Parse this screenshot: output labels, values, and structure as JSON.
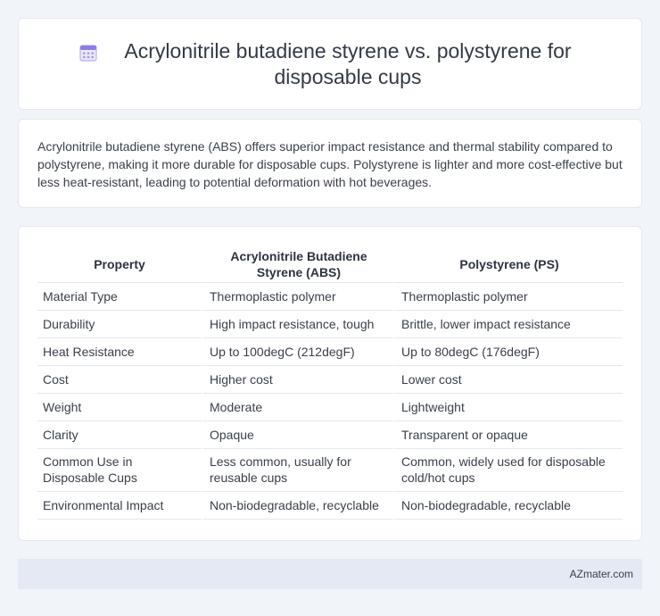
{
  "header": {
    "title": "Acrylonitrile butadiene styrene vs. polystyrene for disposable cups",
    "icon": "calendar-icon"
  },
  "summary": {
    "text": "Acrylonitrile butadiene styrene (ABS) offers superior impact resistance and thermal stability compared to polystyrene, making it more durable for disposable cups. Polystyrene is lighter and more cost-effective but less heat-resistant, leading to potential deformation with hot beverages."
  },
  "table": {
    "headers": [
      "Property",
      "Acrylonitrile Butadiene Styrene (ABS)",
      "Polystyrene (PS)"
    ],
    "rows": [
      [
        "Material Type",
        "Thermoplastic polymer",
        "Thermoplastic polymer"
      ],
      [
        "Durability",
        "High impact resistance, tough",
        "Brittle, lower impact resistance"
      ],
      [
        "Heat Resistance",
        "Up to 100degC (212degF)",
        "Up to 80degC (176degF)"
      ],
      [
        "Cost",
        "Higher cost",
        "Lower cost"
      ],
      [
        "Weight",
        "Moderate",
        "Lightweight"
      ],
      [
        "Clarity",
        "Opaque",
        "Transparent or opaque"
      ],
      [
        "Common Use in Disposable Cups",
        "Less common, usually for reusable cups",
        "Common, widely used for disposable cold/hot cups"
      ],
      [
        "Environmental Impact",
        "Non-biodegradable, recyclable",
        "Non-biodegradable, recyclable"
      ]
    ]
  },
  "footer": {
    "brand": "AZmater.com"
  },
  "colors": {
    "background": "#f1f4f8",
    "card": "#ffffff",
    "border": "#e3e7ee",
    "footer": "#e4e9f3",
    "icon_accent": "#8a7fe0"
  }
}
